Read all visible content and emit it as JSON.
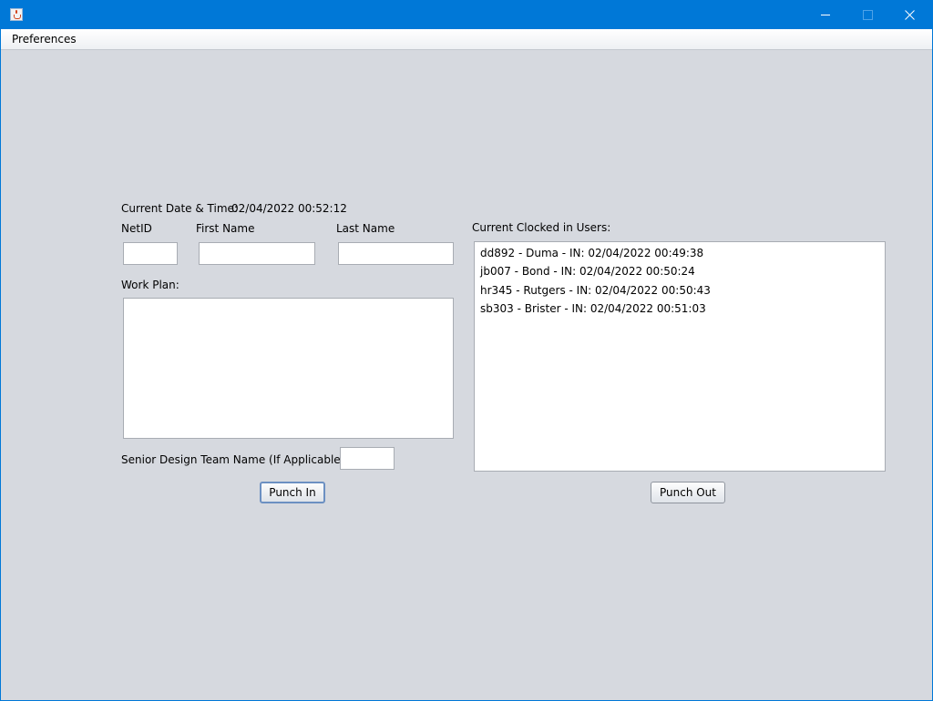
{
  "window": {
    "title": "",
    "accent": "#0078d7",
    "background": "#d6d9df"
  },
  "menu": {
    "items": [
      {
        "label": "Preferences"
      }
    ]
  },
  "form": {
    "datetime_label": "Current Date & Time:",
    "datetime_value": "02/04/2022 00:52:12",
    "netid_label": "NetID",
    "netid_value": "",
    "first_name_label": "First Name",
    "first_name_value": "",
    "last_name_label": "Last Name",
    "last_name_value": "",
    "work_plan_label": "Work Plan:",
    "work_plan_value": "",
    "team_label": "Senior Design Team Name (If Applicable):",
    "team_value": "",
    "punch_in_label": "Punch In"
  },
  "clocked": {
    "label": "Current Clocked in Users:",
    "users": [
      "dd892 - Duma - IN: 02/04/2022 00:49:38",
      "jb007 - Bond - IN: 02/04/2022 00:50:24",
      "hr345 - Rutgers - IN: 02/04/2022 00:50:43",
      "sb303 - Brister - IN: 02/04/2022 00:51:03"
    ],
    "punch_out_label": "Punch Out"
  },
  "icons": {
    "app": "java-app-icon",
    "minimize": "minimize-icon",
    "maximize": "maximize-icon",
    "close": "close-icon"
  }
}
